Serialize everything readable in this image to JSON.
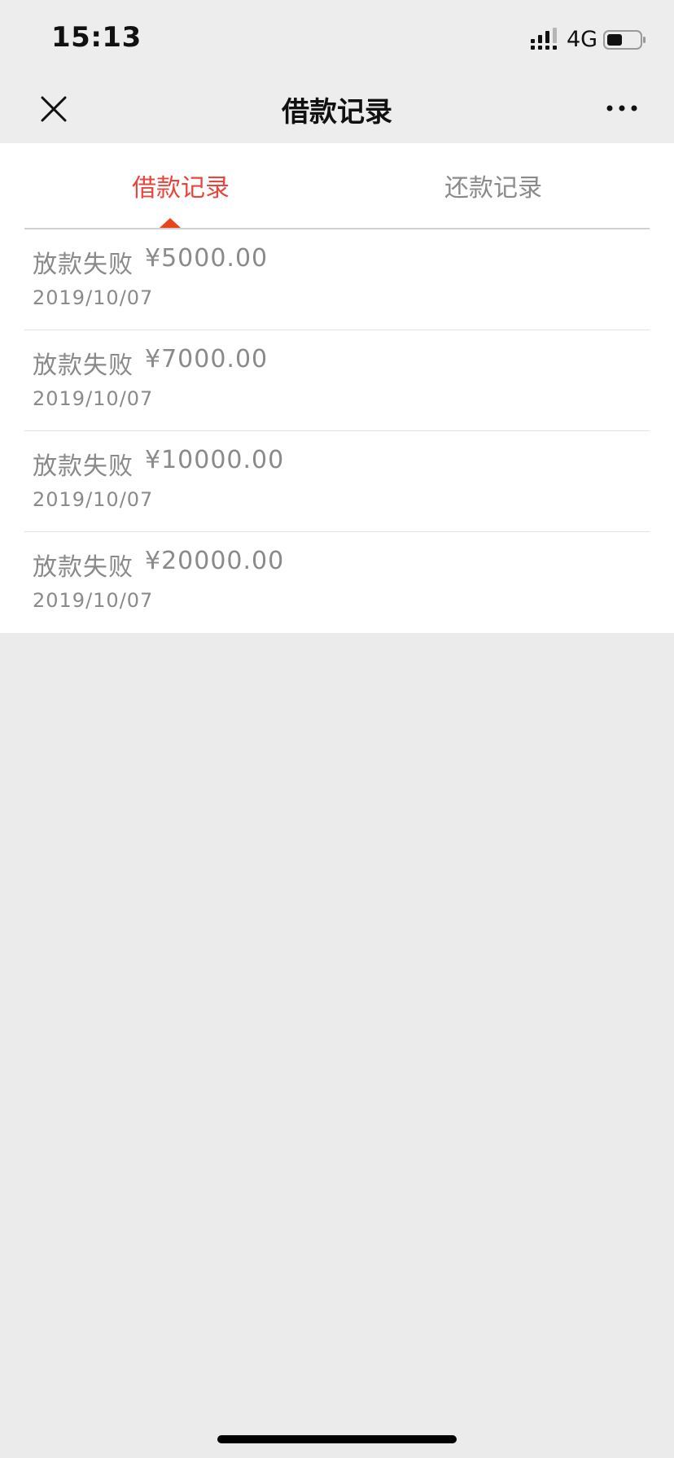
{
  "status_bar": {
    "time": "15:13",
    "network": "4G",
    "icons": [
      "signal-icon",
      "battery-icon"
    ]
  },
  "nav": {
    "title": "借款记录",
    "icons": [
      "close-icon",
      "more-icon"
    ]
  },
  "tabs": [
    {
      "label": "借款记录",
      "active": true
    },
    {
      "label": "还款记录",
      "active": false
    }
  ],
  "records": [
    {
      "status": "放款失败",
      "amount": "¥5000.00",
      "date": "2019/10/07"
    },
    {
      "status": "放款失败",
      "amount": "¥7000.00",
      "date": "2019/10/07"
    },
    {
      "status": "放款失败",
      "amount": "¥10000.00",
      "date": "2019/10/07"
    },
    {
      "status": "放款失败",
      "amount": "¥20000.00",
      "date": "2019/10/07"
    }
  ],
  "colors": {
    "active_tab": "#e8453c",
    "indicator": "#e8431f",
    "muted_text": "#8a8a8a",
    "background": "#ebebeb"
  }
}
